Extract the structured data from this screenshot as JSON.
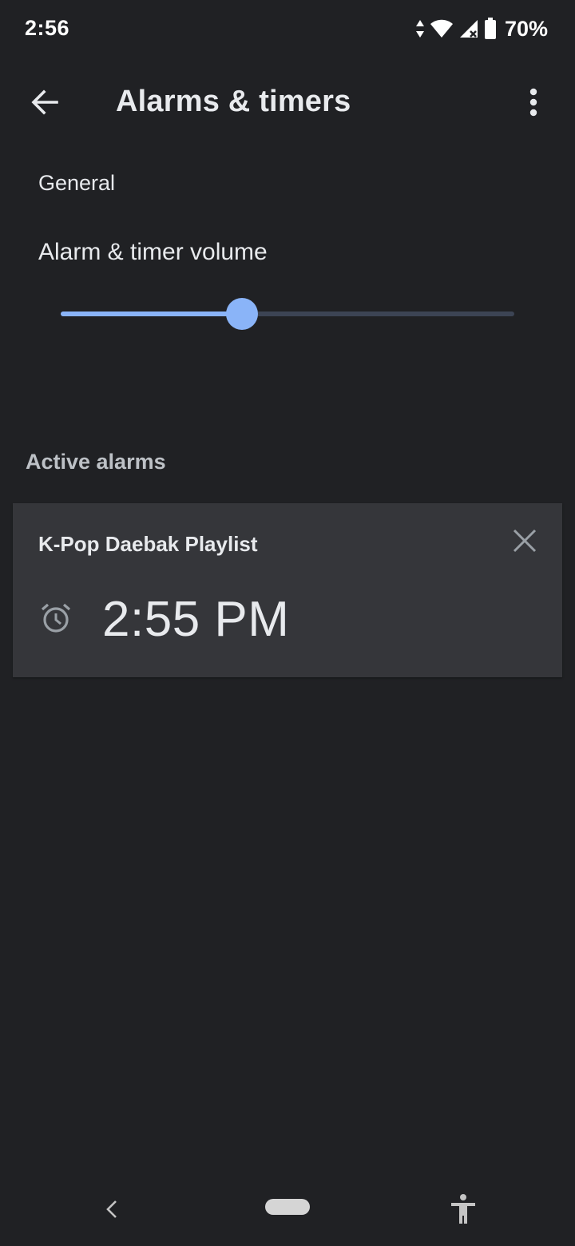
{
  "status_bar": {
    "time": "2:56",
    "battery": "70%",
    "icons": [
      "data-arrows-icon",
      "wifi-icon",
      "signal-icon",
      "battery-icon"
    ]
  },
  "app_bar": {
    "title": "Alarms & timers",
    "back_icon": "arrow-back-icon",
    "overflow_icon": "more-vert-icon"
  },
  "general": {
    "header": "General",
    "volume_label": "Alarm & timer volume",
    "volume_level": 0.4
  },
  "active_alarms": {
    "header": "Active alarms",
    "items": [
      {
        "name": "K-Pop Daebak Playlist",
        "time": "2:55 PM",
        "icon": "alarm-clock-icon",
        "dismiss_icon": "close-icon"
      }
    ]
  },
  "nav_bar": {
    "icons": [
      "nav-back-icon",
      "home-pill",
      "accessibility-icon"
    ]
  },
  "colors": {
    "background": "#202124",
    "card": "#35363a",
    "accent": "#8ab4f8",
    "track": "#3c4454",
    "text": "#e8eaed"
  }
}
